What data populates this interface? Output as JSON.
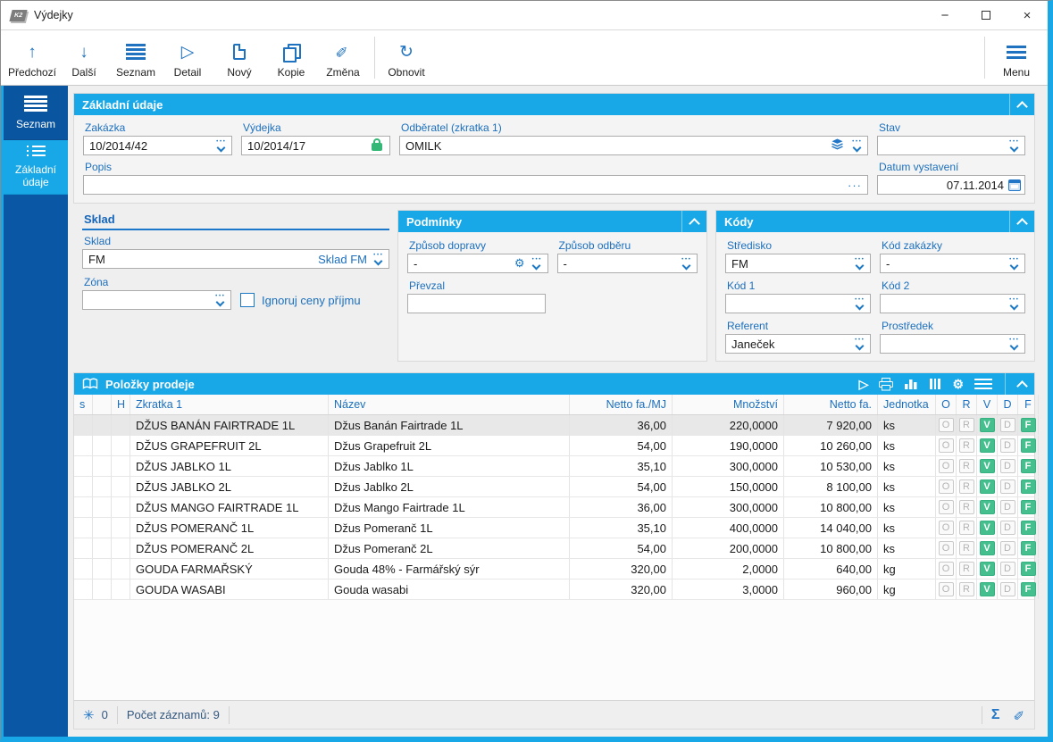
{
  "window": {
    "title": "Výdejky",
    "app_icon": "K2"
  },
  "titlebar": {
    "minimize_icon": "−",
    "close_icon": "×"
  },
  "toolbar": {
    "buttons": [
      {
        "label": "Předchozí",
        "icon": "arrow-up"
      },
      {
        "label": "Další",
        "icon": "arrow-down"
      },
      {
        "label": "Seznam",
        "icon": "list-bars"
      },
      {
        "label": "Detail",
        "icon": "play-outline"
      },
      {
        "label": "Nový",
        "icon": "document"
      },
      {
        "label": "Kopie",
        "icon": "copy"
      },
      {
        "label": "Změna",
        "icon": "pencil"
      },
      {
        "label": "Obnovit",
        "icon": "refresh"
      }
    ],
    "icon_glyphs": {
      "arrow_up": "↑",
      "arrow_down": "↓",
      "play": "▷",
      "pencil": "✎",
      "refresh": "↻",
      "gear": "⚙"
    },
    "menu": {
      "label": "Menu"
    }
  },
  "sidebar": {
    "items": [
      {
        "label": "Seznam",
        "active": false
      },
      {
        "label": "Základní údaje",
        "active": true
      }
    ]
  },
  "form": {
    "title": "Základní údaje",
    "zakazka": {
      "label": "Zakázka",
      "value": "10/2014/42"
    },
    "vydejka": {
      "label": "Výdejka",
      "value": "10/2014/17"
    },
    "odberatel": {
      "label": "Odběratel (zkratka 1)",
      "value": "OMILK"
    },
    "stav": {
      "label": "Stav",
      "value": ""
    },
    "popis": {
      "label": "Popis",
      "value": "",
      "more_icon": "···"
    },
    "datum": {
      "label": "Datum vystavení",
      "value": "07.11.2014"
    }
  },
  "sklad": {
    "title": "Sklad",
    "sklad": {
      "label": "Sklad",
      "value": "FM",
      "detail": "Sklad FM"
    },
    "zona": {
      "label": "Zóna",
      "value": ""
    },
    "ignoruj": {
      "label": "Ignoruj ceny příjmu",
      "checked": false
    }
  },
  "podminky": {
    "title": "Podmínky",
    "doprava": {
      "label": "Způsob dopravy",
      "value": "-"
    },
    "odber": {
      "label": "Způsob odběru",
      "value": "-"
    },
    "prevzal": {
      "label": "Převzal",
      "value": ""
    }
  },
  "kody": {
    "title": "Kódy",
    "stredisko": {
      "label": "Středisko",
      "value": "FM"
    },
    "kod_zakazky": {
      "label": "Kód zakázky",
      "value": "-"
    },
    "kod1": {
      "label": "Kód 1",
      "value": ""
    },
    "kod2": {
      "label": "Kód 2",
      "value": ""
    },
    "referent": {
      "label": "Referent",
      "value": "Janeček"
    },
    "prostredek": {
      "label": "Prostředek",
      "value": ""
    }
  },
  "table": {
    "title": "Položky prodeje",
    "columns": {
      "s": "s",
      "h": "H",
      "zkratka": "Zkratka 1",
      "nazev": "Název",
      "netto_mj": "Netto fa./MJ",
      "mnozstvi": "Množství",
      "netto": "Netto fa.",
      "jednotka": "Jednotka",
      "o": "O",
      "r": "R",
      "v": "V",
      "d": "D",
      "f": "F"
    },
    "flags": {
      "o": "O",
      "r": "R",
      "v": "V",
      "d": "D",
      "f": "F"
    },
    "selected_row": 0,
    "rows": [
      {
        "zkratka": "DŽUS BANÁN FAIRTRADE 1L",
        "nazev": "Džus Banán Fairtrade 1L",
        "netto_mj": "36,00",
        "mnozstvi": "220,0000",
        "netto": "7 920,00",
        "jednotka": "ks"
      },
      {
        "zkratka": "DŽUS GRAPEFRUIT 2L",
        "nazev": "Džus Grapefruit 2L",
        "netto_mj": "54,00",
        "mnozstvi": "190,0000",
        "netto": "10 260,00",
        "jednotka": "ks"
      },
      {
        "zkratka": "DŽUS JABLKO 1L",
        "nazev": "Džus Jablko 1L",
        "netto_mj": "35,10",
        "mnozstvi": "300,0000",
        "netto": "10 530,00",
        "jednotka": "ks"
      },
      {
        "zkratka": "DŽUS JABLKO 2L",
        "nazev": "Džus Jablko 2L",
        "netto_mj": "54,00",
        "mnozstvi": "150,0000",
        "netto": "8 100,00",
        "jednotka": "ks"
      },
      {
        "zkratka": "DŽUS MANGO FAIRTRADE 1L",
        "nazev": "Džus Mango Fairtrade 1L",
        "netto_mj": "36,00",
        "mnozstvi": "300,0000",
        "netto": "10 800,00",
        "jednotka": "ks"
      },
      {
        "zkratka": "DŽUS POMERANČ 1L",
        "nazev": "Džus Pomeranč 1L",
        "netto_mj": "35,10",
        "mnozstvi": "400,0000",
        "netto": "14 040,00",
        "jednotka": "ks"
      },
      {
        "zkratka": "DŽUS POMERANČ 2L",
        "nazev": "Džus Pomeranč 2L",
        "netto_mj": "54,00",
        "mnozstvi": "200,0000",
        "netto": "10 800,00",
        "jednotka": "ks"
      },
      {
        "zkratka": "GOUDA FARMAŘSKÝ",
        "nazev": "Gouda 48% - Farmářský sýr",
        "netto_mj": "320,00",
        "mnozstvi": "2,0000",
        "netto": "640,00",
        "jednotka": "kg"
      },
      {
        "zkratka": "GOUDA WASABI",
        "nazev": "Gouda wasabi",
        "netto_mj": "320,00",
        "mnozstvi": "3,0000",
        "netto": "960,00",
        "jednotka": "kg"
      }
    ],
    "footer": {
      "flake_icon": "✳",
      "flake_count": "0",
      "records": "Počet záznamů: 9",
      "sum_icon": "Σ",
      "edit_icon": "✎"
    }
  },
  "colors": {
    "accent": "#18A8E8",
    "sidebar": "#0A57A5",
    "flag_green": "#44BF8D",
    "label_blue": "#1B6FBE",
    "lock_green": "#35B877"
  }
}
